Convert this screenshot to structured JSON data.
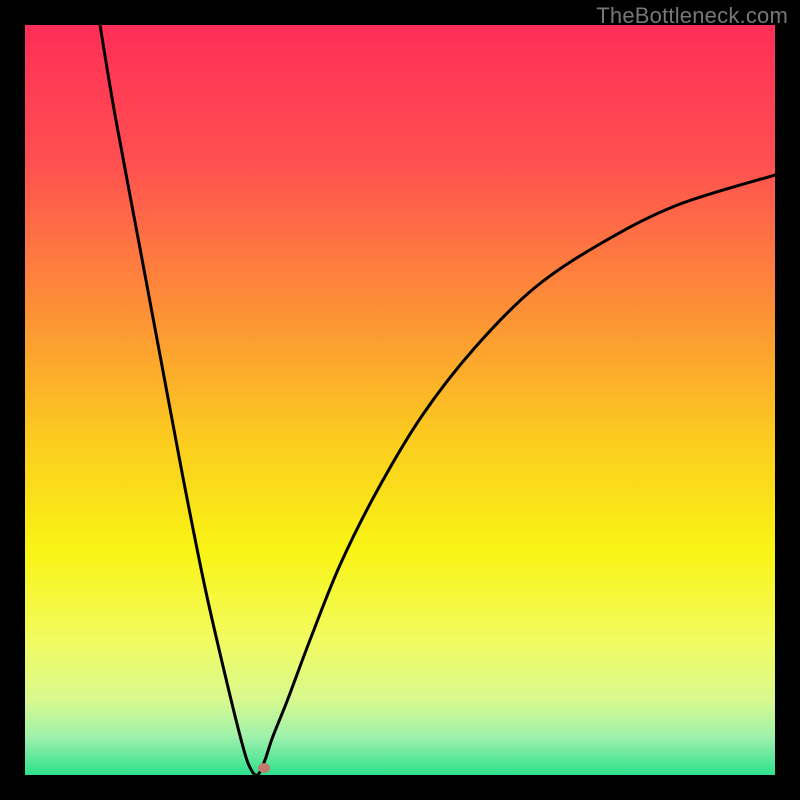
{
  "watermark": "TheBottleneck.com",
  "chart_data": {
    "type": "line",
    "title": "",
    "xlabel": "",
    "ylabel": "",
    "xlim": [
      0,
      100
    ],
    "ylim": [
      0,
      100
    ],
    "grid": false,
    "legend": false,
    "curve": {
      "name": "bottleneck-curve",
      "description": "V-shaped performance mismatch curve with a minimum near x≈31",
      "x": [
        10,
        12,
        15,
        18,
        21,
        24,
        27,
        29,
        30,
        31,
        32,
        33,
        35,
        38,
        42,
        47,
        53,
        60,
        68,
        77,
        87,
        100
      ],
      "y": [
        100,
        88,
        72,
        56,
        40,
        25,
        12,
        4,
        1,
        0,
        2,
        5,
        10,
        18,
        28,
        38,
        48,
        57,
        65,
        71,
        76,
        80
      ]
    },
    "marker": {
      "x": 31.8,
      "y": 1.0,
      "color": "#C17A6F"
    },
    "background_gradient": {
      "stops": [
        {
          "pos": 0.0,
          "color": "#FF2E57"
        },
        {
          "pos": 0.18,
          "color": "#FF4F51"
        },
        {
          "pos": 0.38,
          "color": "#FD9036"
        },
        {
          "pos": 0.55,
          "color": "#FBCB1F"
        },
        {
          "pos": 0.7,
          "color": "#F9F414"
        },
        {
          "pos": 0.82,
          "color": "#F2FB60"
        },
        {
          "pos": 0.9,
          "color": "#D8F98F"
        },
        {
          "pos": 0.95,
          "color": "#9DF1AC"
        },
        {
          "pos": 1.0,
          "color": "#2CE08D"
        }
      ]
    }
  }
}
